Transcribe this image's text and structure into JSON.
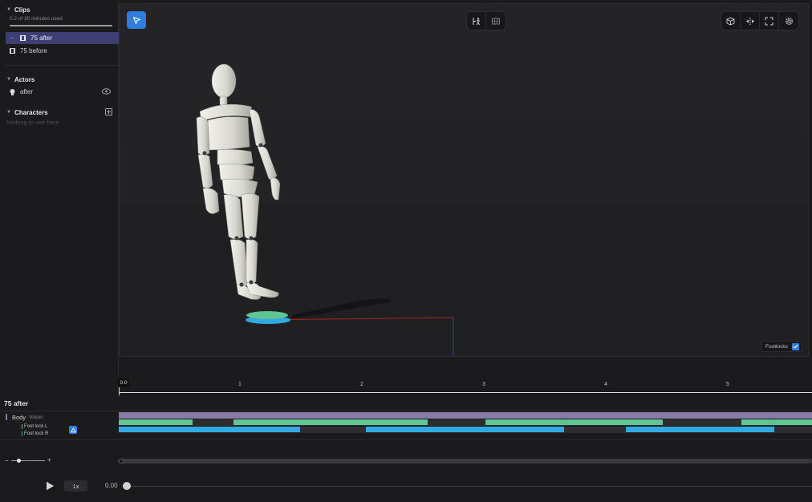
{
  "sidebar": {
    "clips_title": "Clips",
    "usage_text": "0.2 of 30 minutes used",
    "usage_fraction": 0.007,
    "clips": [
      {
        "label": "75 after",
        "active": true
      },
      {
        "label": "75 before",
        "active": false
      }
    ],
    "actors_title": "Actors",
    "actors": [
      {
        "label": "after"
      }
    ],
    "characters_title": "Characters",
    "characters_empty": "Nothing to see here"
  },
  "viewport": {
    "footlocks_label": "Footlocks",
    "footlocks_checked": true
  },
  "timeline": {
    "clip_name": "75 after",
    "playhead_label": "0.0",
    "ticks": [
      "1",
      "2",
      "3",
      "4",
      "5"
    ],
    "track_label": "Body",
    "track_sublabel": "Vision",
    "foot_l_label": "Foot lock L",
    "foot_r_label": "Foot lock R",
    "zoom_minus": "−",
    "zoom_plus": "+",
    "speed_label": "1x",
    "time_value": "0.00"
  },
  "colors": {
    "accent": "#2e7de0",
    "active_row": "#3d3e74",
    "foot_l": "#5ec593",
    "foot_r": "#32a9e0",
    "body_track": "#8a7aa8"
  }
}
